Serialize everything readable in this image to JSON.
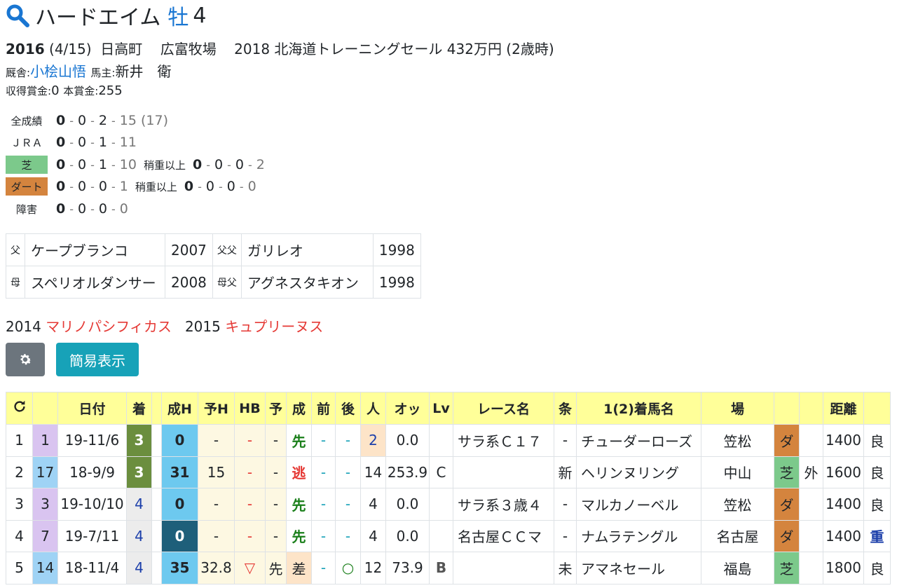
{
  "horse": {
    "name": "ハードエイム",
    "sex": "牡",
    "age": "4"
  },
  "birth": {
    "year": "2016",
    "date": "(4/15)",
    "area": "日高町",
    "farm": "広富牧場",
    "sale": "2018 北海道トレーニングセール 432万円 (2歳時)"
  },
  "connections": {
    "trainer_label": "厩舎:",
    "trainer": "小桧山悟",
    "owner_label": "馬主:",
    "owner": "新井　衛"
  },
  "money": {
    "earned_label": "収得賞金:",
    "earned": "0",
    "prize_label": "本賞金:",
    "prize": "255"
  },
  "records": [
    {
      "label": "全成績",
      "style": "plain",
      "w1": "0",
      "w2": "0",
      "w3": "2",
      "out": "15 (17)"
    },
    {
      "label": "ＪＲＡ",
      "style": "plain",
      "w1": "0",
      "w2": "0",
      "w3": "1",
      "out": "11"
    },
    {
      "label": "芝",
      "style": "shiba",
      "w1": "0",
      "w2": "0",
      "w3": "1",
      "out": "10",
      "heavy_label": "稍重以上",
      "h1": "0",
      "h2": "0",
      "h3": "0",
      "hout": "2"
    },
    {
      "label": "ダート",
      "style": "dirt",
      "w1": "0",
      "w2": "0",
      "w3": "0",
      "out": "1",
      "heavy_label": "稍重以上",
      "h1": "0",
      "h2": "0",
      "h3": "0",
      "hout": "0"
    },
    {
      "label": "障害",
      "style": "plain",
      "w1": "0",
      "w2": "0",
      "w3": "0",
      "out": "0"
    }
  ],
  "pedigree": [
    {
      "k1": "父",
      "n1": "ケープブランコ",
      "y1": "2007",
      "k2": "父父",
      "n2": "ガリレオ",
      "y2": "1998"
    },
    {
      "k1": "母",
      "n1": "スペリオルダンサー",
      "y1": "2008",
      "k2": "母父",
      "n2": "アグネスタキオン",
      "y2": "1998"
    }
  ],
  "siblings": [
    {
      "year": "2014",
      "name": "マリノパシフィカス"
    },
    {
      "year": "2015",
      "name": "キュプリーヌス"
    }
  ],
  "buttons": {
    "settings_icon": "gear-icon",
    "simple_label": "簡易表示"
  },
  "table": {
    "headers": [
      "",
      "",
      "日付",
      "着",
      "",
      "成H",
      "予H",
      "HB",
      "予",
      "成",
      "前",
      "後",
      "人",
      "オッ",
      "Lv",
      "レース名",
      "条",
      "1(2)着馬名",
      "場",
      "",
      "",
      "距離",
      ""
    ],
    "rows": [
      {
        "no": "1",
        "waku": "1",
        "date": "19-11/6",
        "chaku": "3",
        "seiH": "0",
        "yoH": "-",
        "hb": "-",
        "yo": "-",
        "sei": "先",
        "mae": "-",
        "ato": "-",
        "ninki": "2",
        "odds": "0.0",
        "lv": "",
        "race": "サラ系Ｃ１７",
        "jo": "-",
        "winner": "チューダーローズ",
        "place": "笠松",
        "track": "ダ",
        "inout": "",
        "dist": "1400",
        "cond": "良"
      },
      {
        "no": "2",
        "waku": "17",
        "date": "18-9/9",
        "chaku": "3",
        "seiH": "31",
        "yoH": "15",
        "hb": "-",
        "yo": "-",
        "sei": "逃",
        "mae": "-",
        "ato": "-",
        "ninki": "14",
        "odds": "253.9",
        "lv": "C",
        "race": "",
        "jo": "新",
        "winner": "ヘリンヌリング",
        "place": "中山",
        "track": "芝",
        "inout": "外",
        "dist": "1600",
        "cond": "良"
      },
      {
        "no": "3",
        "waku": "3",
        "date": "19-10/10",
        "chaku": "4",
        "seiH": "0",
        "yoH": "-",
        "hb": "-",
        "yo": "-",
        "sei": "先",
        "mae": "-",
        "ato": "-",
        "ninki": "4",
        "odds": "0.0",
        "lv": "",
        "race": "サラ系３歳４",
        "jo": "-",
        "winner": "マルカノーベル",
        "place": "笠松",
        "track": "ダ",
        "inout": "",
        "dist": "1400",
        "cond": "良"
      },
      {
        "no": "4",
        "waku": "7",
        "date": "19-7/11",
        "chaku": "4",
        "seiH": "0",
        "yoH": "-",
        "hb": "-",
        "yo": "-",
        "sei": "先",
        "mae": "-",
        "ato": "-",
        "ninki": "4",
        "odds": "0.0",
        "lv": "",
        "race": "名古屋ＣＣマ",
        "jo": "-",
        "winner": "ナムラテングル",
        "place": "名古屋",
        "track": "ダ",
        "inout": "",
        "dist": "1400",
        "cond": "重"
      },
      {
        "no": "5",
        "waku": "14",
        "date": "18-11/4",
        "chaku": "4",
        "seiH": "35",
        "yoH": "32.8",
        "hb": "▽",
        "yo": "先",
        "sei": "差",
        "mae": "-",
        "ato": "○",
        "ninki": "12",
        "odds": "73.9",
        "lv": "B",
        "race": "",
        "jo": "未",
        "winner": "アマネセール",
        "place": "福島",
        "track": "芝",
        "inout": "",
        "dist": "1800",
        "cond": "良"
      }
    ]
  },
  "colors": {
    "link": "#1976d2",
    "red": "#e53935",
    "header_bg": "#ffff99",
    "button_gray": "#6c757d",
    "button_teal": "#17a2b8",
    "shiba": "#7cc98b",
    "dirt": "#d4843e"
  }
}
